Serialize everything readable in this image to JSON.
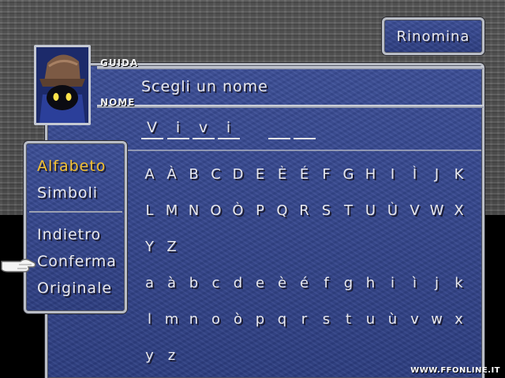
{
  "screen": {
    "title_button": "Rinomina",
    "guide_label": "GUIDA",
    "guide_text": "Scegli un nome",
    "name_label": "NOME",
    "name_slots": [
      "V",
      "i",
      "v",
      "i",
      "",
      "",
      ""
    ],
    "name_cursor_index": 5
  },
  "menu": {
    "categories": [
      {
        "label": "Alfabeto",
        "selected": true
      },
      {
        "label": "Simboli",
        "selected": false
      }
    ],
    "commands": [
      "Indietro",
      "Conferma",
      "Originale"
    ],
    "pointer_at": "Conferma"
  },
  "glyph_rows": [
    [
      "A",
      "À",
      "B",
      "C",
      "D",
      "E",
      "È",
      "É",
      "F",
      "G",
      "H",
      "I",
      "Ì",
      "J",
      "K"
    ],
    [
      "L",
      "M",
      "N",
      "O",
      "Ò",
      "P",
      "Q",
      "R",
      "S",
      "T",
      "U",
      "Ù",
      "V",
      "W",
      "X"
    ],
    [
      "Y",
      "Z"
    ],
    [
      "a",
      "à",
      "b",
      "c",
      "d",
      "e",
      "è",
      "é",
      "f",
      "g",
      "h",
      "i",
      "ì",
      "j",
      "k"
    ],
    [
      "l",
      "m",
      "n",
      "o",
      "ò",
      "p",
      "q",
      "r",
      "s",
      "t",
      "u",
      "ù",
      "v",
      "w",
      "x"
    ],
    [
      "y",
      "z"
    ]
  ],
  "watermark": "WWW.FFONLINE.IT",
  "colors": {
    "window_blue": "#34468c",
    "border": "#b9bdc6",
    "selected_text": "#f3c030",
    "text": "#e8e8ec"
  }
}
